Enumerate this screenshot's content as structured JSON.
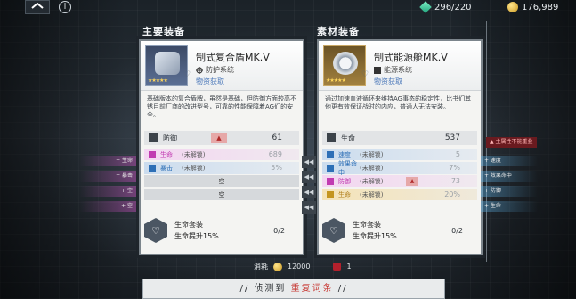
{
  "topbar": {
    "gem_count": "296/220",
    "coin_count": "176,989",
    "info_glyph": "i"
  },
  "main": {
    "section_title": "主要装备",
    "name": "制式复合盾MK.V",
    "type": "防护系统",
    "source": "物资获取",
    "stars": "★★★★★",
    "description": "基础版本的复合盾牌，虽然是基础，但防御方面较高不锈目前厂商的改进型号，可靠的性能保障着AG们的安全。",
    "stat_label": "防御",
    "stat_value": "61",
    "warn": "▲",
    "subs": [
      {
        "label": "生命",
        "note": "(未解锁)",
        "value": "689"
      },
      {
        "label": "暴击",
        "note": "(未解锁)",
        "value": "5%"
      },
      {
        "label": "空"
      },
      {
        "label": "空"
      }
    ],
    "bonus_title": "生命套装",
    "bonus_desc": "生命提升15%",
    "bonus_count": "0/2"
  },
  "material": {
    "section_title": "素材装备",
    "name": "制式能源舱MK.V",
    "type": "能源系统",
    "source": "物资获取",
    "stars": "★★★★★",
    "description": "通过加速血液循环来维持AG事态的稳定性，比书们其他更有效保证战时的内应，普通人无法安装。",
    "stat_label": "生命",
    "stat_value": "537",
    "subs": [
      {
        "label": "速度",
        "note": "(未解锁)",
        "value": "5"
      },
      {
        "label": "效果命中",
        "note": "(未解锁)",
        "value": "7%"
      },
      {
        "label": "防御",
        "note": "(未解锁)",
        "value": "73",
        "warn": "▲"
      },
      {
        "label": "生命",
        "note": "(未解锁)",
        "value": "20%"
      }
    ],
    "bonus_title": "生命套装",
    "bonus_desc": "生命提升15%",
    "bonus_count": "0/2"
  },
  "side_left": [
    "+ 生命",
    "+ 暴击",
    "+ 空",
    "+ 空"
  ],
  "side_right": [
    "+ 速度",
    "+ 效果命中",
    "+ 防御",
    "+ 生命"
  ],
  "warning_tag": "▲ 主属性不能重叠",
  "cost": {
    "label": "消耗",
    "coins": "12000",
    "items": "1"
  },
  "detect": {
    "prefix": "// 侦测到",
    "highlight": "重复词条",
    "suffix": "//"
  }
}
